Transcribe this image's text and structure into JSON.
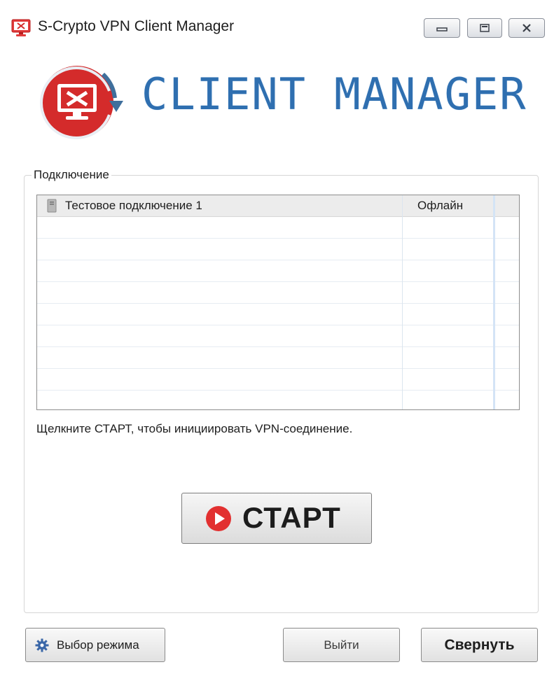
{
  "window": {
    "title": "S-Crypto VPN Client Manager",
    "icon": "monitor-tools-icon",
    "controls": [
      "minimize-icon",
      "maximize-icon",
      "close-icon"
    ]
  },
  "logo": {
    "text": "CLIENT MANAGER",
    "icon": "monitor-tools-icon",
    "accent_color": "#d42b2b",
    "text_color": "#2f6fb0"
  },
  "connection_group": {
    "label": "Подключение",
    "connections": [
      {
        "name": "Тестовое подключение 1",
        "status": "Офлайн",
        "icon": "server-icon"
      }
    ]
  },
  "hint": "Щелкните СТАРТ, чтобы инициировать VPN-соединение.",
  "start_button": {
    "label": "СТАРТ",
    "icon": "play-circle-icon",
    "icon_color": "#e23030"
  },
  "footer": {
    "mode_button": {
      "label": "Выбор режима",
      "icon": "gear-icon"
    },
    "exit_button": {
      "label": "Выйти"
    },
    "collapse_button": {
      "label": "Свернуть"
    }
  }
}
